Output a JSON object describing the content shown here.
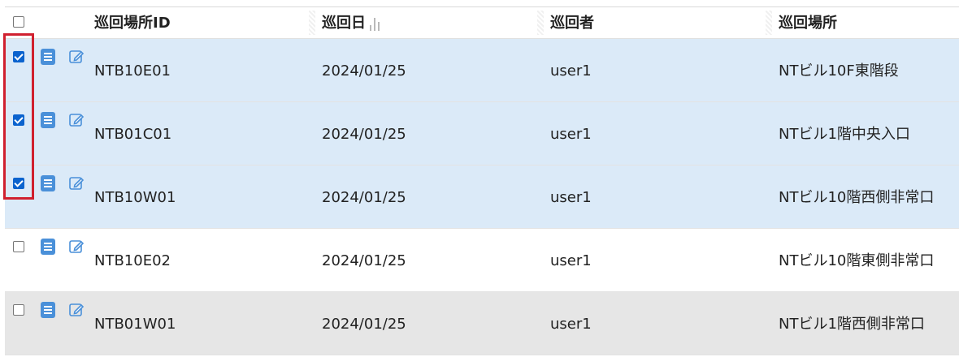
{
  "table": {
    "columns": {
      "id": "巡回場所ID",
      "date": "巡回日",
      "user": "巡回者",
      "place": "巡回場所"
    },
    "sort_icon": "bar-chart-icon",
    "rows": [
      {
        "id": "NTB10E01",
        "date": "2024/01/25",
        "user": "user1",
        "place": "NTビル10F東階段",
        "checked": true
      },
      {
        "id": "NTB01C01",
        "date": "2024/01/25",
        "user": "user1",
        "place": "NTビル1階中央入口",
        "checked": true
      },
      {
        "id": "NTB10W01",
        "date": "2024/01/25",
        "user": "user1",
        "place": "NTビル10階西側非常口",
        "checked": true
      },
      {
        "id": "NTB10E02",
        "date": "2024/01/25",
        "user": "user1",
        "place": "NTビル10階東側非常口",
        "checked": false
      },
      {
        "id": "NTB01W01",
        "date": "2024/01/25",
        "user": "user1",
        "place": "NTビル1階西側非常口",
        "checked": false
      }
    ],
    "row_icons": [
      "document-icon",
      "edit-icon"
    ],
    "colors": {
      "selected_row": "#dbeaf8",
      "alt_row": "#e6e6e6",
      "icon_blue": "#4a90d9",
      "highlight": "#d0202f"
    }
  }
}
